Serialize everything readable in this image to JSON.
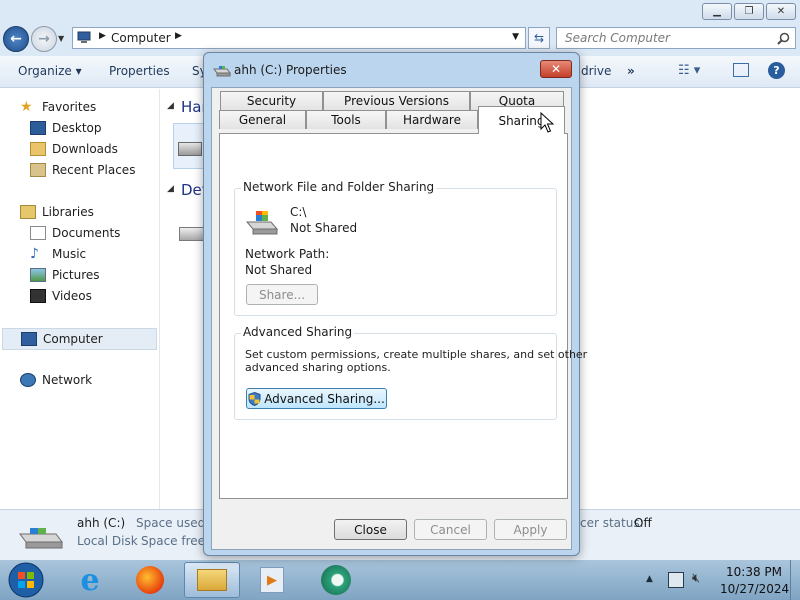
{
  "explorer": {
    "address_path": "Computer",
    "search_placeholder": "Search Computer",
    "toolbar": {
      "organize": "Organize",
      "properties": "Properties",
      "sys_partial": "Sy",
      "drive_partial": "drive",
      "more": "»"
    },
    "nav": {
      "favorites": "Favorites",
      "desktop": "Desktop",
      "downloads": "Downloads",
      "recent_places": "Recent Places",
      "libraries": "Libraries",
      "documents": "Documents",
      "music": "Music",
      "pictures": "Pictures",
      "videos": "Videos",
      "computer": "Computer",
      "network": "Network"
    },
    "content": {
      "group1_partial": "Har",
      "group2_partial": "Dev"
    },
    "details": {
      "drive_name": "ahh (C:)",
      "drive_type": "Local Disk",
      "space_used_label": "Space used:",
      "space_free_label": "Space free:",
      "status_partial": "cer status:",
      "status_value": "Off"
    }
  },
  "dialog": {
    "title": "ahh (C:) Properties",
    "tabs_back": [
      "Security",
      "Previous Versions",
      "Quota"
    ],
    "tabs_front": [
      "General",
      "Tools",
      "Hardware",
      "Sharing"
    ],
    "network_sharing": {
      "title": "Network File and Folder Sharing",
      "path": "C:\\",
      "status": "Not Shared",
      "network_path_label": "Network Path:",
      "network_path_value": "Not Shared",
      "share_button": "Share..."
    },
    "advanced_sharing": {
      "title": "Advanced Sharing",
      "description_line1": "Set custom permissions, create multiple shares, and set other",
      "description_line2": "advanced sharing options.",
      "button": "Advanced Sharing..."
    },
    "buttons": {
      "close": "Close",
      "cancel": "Cancel",
      "apply": "Apply"
    }
  },
  "taskbar": {
    "time": "10:38 PM",
    "date": "10/27/2024"
  }
}
